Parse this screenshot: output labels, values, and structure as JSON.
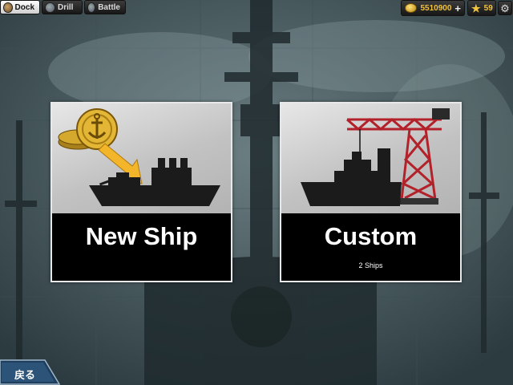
{
  "tabs": [
    {
      "label": "Dock",
      "icon": "dock-icon",
      "active": true
    },
    {
      "label": "Drill",
      "icon": "drill-icon",
      "active": false
    },
    {
      "label": "Battle",
      "icon": "battle-icon",
      "active": false
    }
  ],
  "resources": {
    "coins": "5510900",
    "coins_plus": "+",
    "stars": "59"
  },
  "cards": {
    "new_ship": {
      "title": "New Ship"
    },
    "custom": {
      "title": "Custom",
      "subtitle": "2 Ships"
    }
  },
  "back_button": {
    "label": "戻る"
  },
  "colors": {
    "accent_gold": "#f2c33b",
    "card_border": "#e8e8e8",
    "crane_red": "#b3222a"
  }
}
